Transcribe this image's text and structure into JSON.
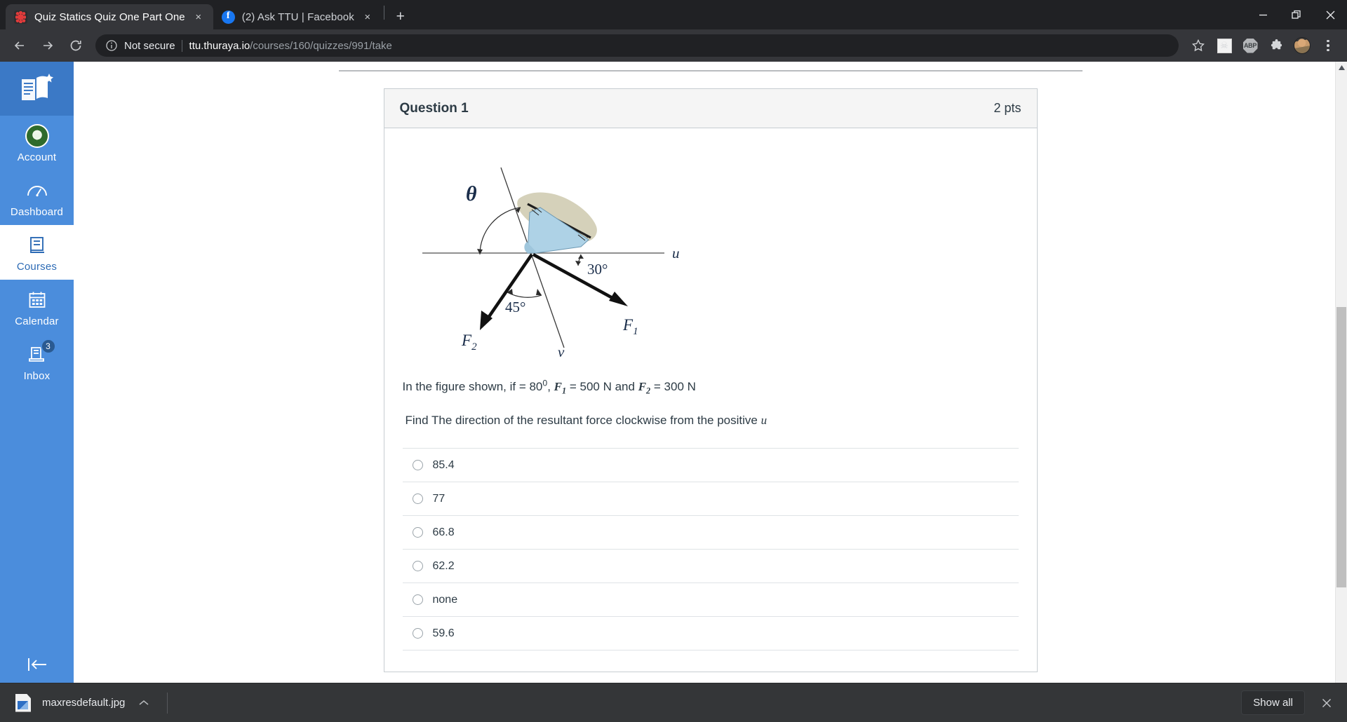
{
  "window": {
    "minimize_label": "Minimize",
    "restore_label": "Restore",
    "close_label": "Close"
  },
  "tabs": [
    {
      "title": "Quiz Statics Quiz One Part One",
      "favicon": "canvas-icon",
      "active": true,
      "close_label": "×"
    },
    {
      "title": "(2) Ask TTU | Facebook",
      "favicon": "facebook-icon",
      "active": false,
      "close_label": "×"
    }
  ],
  "new_tab_label": "+",
  "toolbar": {
    "back_label": "←",
    "forward_label": "→",
    "reload_label": "⟳",
    "security_text": "Not secure",
    "url_host": "ttu.thuraya.io",
    "url_path": "/courses/160/quizzes/991/take",
    "bookmark_icon": "star-icon",
    "extension_1": "skull-flag-icon",
    "extension_2_label": "ABP",
    "extensions_icon": "puzzle-piece-icon",
    "profile_icon": "profile-avatar",
    "menu_icon": "three-dot-menu-icon"
  },
  "sidebar": {
    "logo_name": "canvas-logo",
    "items": [
      {
        "label": "Account",
        "icon": "user-avatar-icon",
        "active": false,
        "badge": null
      },
      {
        "label": "Dashboard",
        "icon": "dashboard-icon",
        "active": false,
        "badge": null
      },
      {
        "label": "Courses",
        "icon": "courses-book-icon",
        "active": true,
        "badge": null
      },
      {
        "label": "Calendar",
        "icon": "calendar-icon",
        "active": false,
        "badge": null
      },
      {
        "label": "Inbox",
        "icon": "inbox-icon",
        "active": false,
        "badge": "3"
      }
    ],
    "collapse_label": "Minimize global navigation"
  },
  "question": {
    "name": "Question 1",
    "points": "2 pts",
    "prompt_lead": "In the figure shown, if ",
    "prompt_eq1": " = 80",
    "prompt_eq1_sup": "0",
    "prompt_comma": ", ",
    "f1_sym": "F",
    "f1_sub": "1",
    "f1_val": " = 500 N and ",
    "f2_sym": "F",
    "f2_sub": "2",
    "f2_val": " = 300 N",
    "prompt_line2": "Find The direction of the resultant force clockwise from the positive ",
    "prompt_line2_axis": "u",
    "answers": [
      {
        "label": "85.4",
        "selected": false
      },
      {
        "label": "77",
        "selected": false
      },
      {
        "label": "66.8",
        "selected": false
      },
      {
        "label": "62.2",
        "selected": false
      },
      {
        "label": "none",
        "selected": false
      },
      {
        "label": "59.6",
        "selected": false
      }
    ]
  },
  "figure": {
    "name": "statics-force-diagram",
    "labels": {
      "theta": "θ",
      "u_axis": "u",
      "v_axis": "v",
      "angle_30": "30°",
      "angle_45": "45°",
      "f1": "F",
      "f1_sub": "1",
      "f2": "F",
      "f2_sub": "2"
    },
    "colors": {
      "bracket": "#aed2e6",
      "surface": "#d5d1ba",
      "axis": "#6b6b6b",
      "vector": "#111111"
    }
  },
  "downloads": {
    "file_name": "maxresdefault.jpg",
    "file_icon": "image-file-icon",
    "expand_label": "⌃",
    "show_all_label": "Show all",
    "close_label": "×"
  },
  "scrollbar": {
    "up_label": "▲",
    "down_label": "▼"
  }
}
